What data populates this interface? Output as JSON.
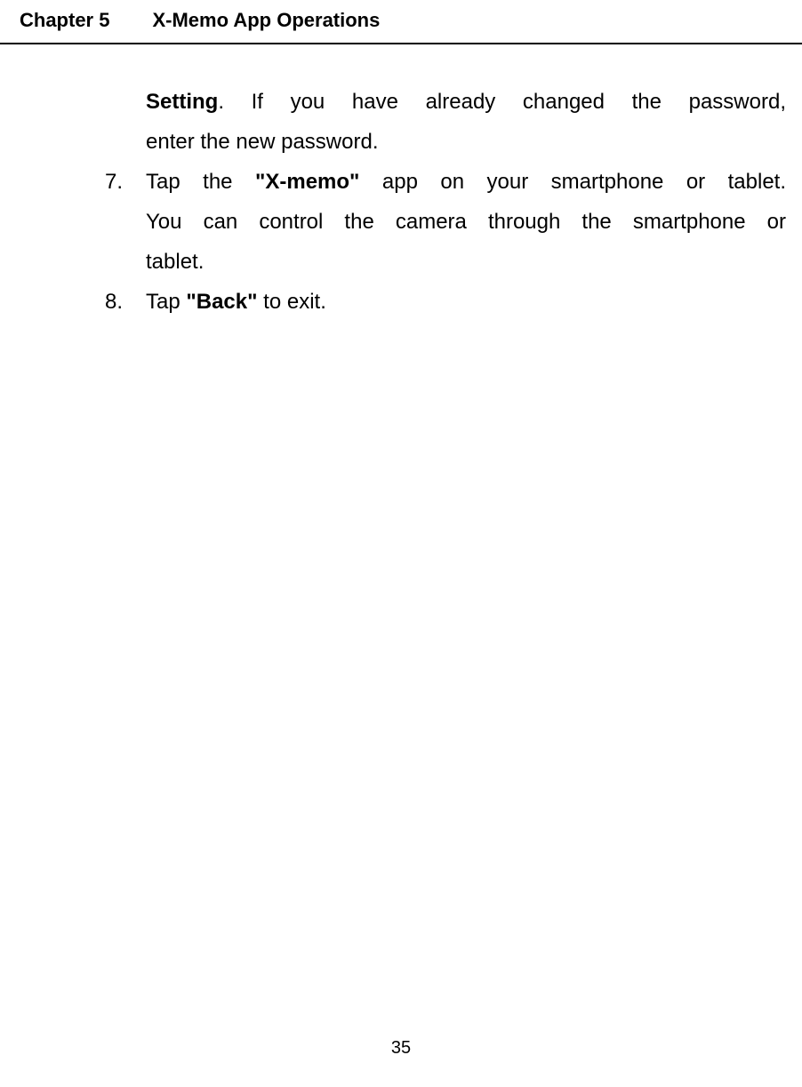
{
  "header": {
    "chapter_label": "Chapter 5",
    "chapter_title": "X-Memo App Operations"
  },
  "body": {
    "prev_item": {
      "line1_bold": "Setting",
      "line1_rest": ". If you have already changed the password,",
      "line2": "enter the new password."
    },
    "item7": {
      "number": "7.",
      "line1_pre": "Tap the ",
      "line1_bold": "\"X-memo\"",
      "line1_post": " app on your smartphone or tablet.",
      "line2": "You can control the camera through the smartphone or",
      "line3": "tablet."
    },
    "item8": {
      "number": "8.",
      "line1_pre": "Tap ",
      "line1_bold": "\"Back\"",
      "line1_post": " to exit."
    }
  },
  "page_number": "35"
}
